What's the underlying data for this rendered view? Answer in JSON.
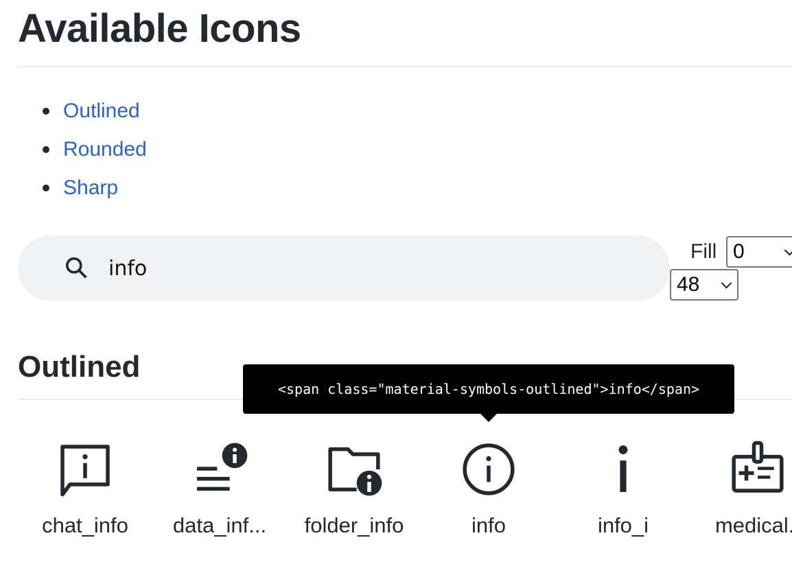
{
  "page": {
    "title": "Available Icons"
  },
  "nav": {
    "items": [
      {
        "label": "Outlined"
      },
      {
        "label": "Rounded"
      },
      {
        "label": "Sharp"
      }
    ],
    "link_color": "#2a63c9"
  },
  "search": {
    "value": "info",
    "placeholder": "",
    "icon": "search-icon"
  },
  "controls": {
    "fill_label": "Fill",
    "fill_value": "0",
    "size_value": "48"
  },
  "section": {
    "title": "Outlined",
    "tooltip": "<span class=\"material-symbols-outlined\">info</span>",
    "icons": [
      {
        "name": "chat_info",
        "label": "chat_info",
        "icon": "chat-info-icon"
      },
      {
        "name": "data_info_alert",
        "label": "data_inf...",
        "icon": "data-info-alert-icon"
      },
      {
        "name": "folder_info",
        "label": "folder_info",
        "icon": "folder-info-icon"
      },
      {
        "name": "info",
        "label": "info",
        "icon": "info-icon"
      },
      {
        "name": "info_i",
        "label": "info_i",
        "icon": "info-i-icon"
      },
      {
        "name": "medical_information",
        "label": "medical..",
        "icon": "medical-information-icon"
      }
    ]
  }
}
